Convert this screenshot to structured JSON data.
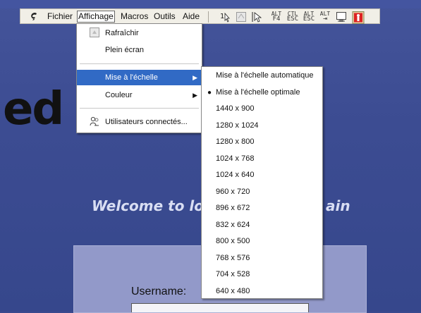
{
  "page": {
    "logo_fragment": "ed",
    "welcome_start": "Welcome to lo",
    "welcome_end": "ain",
    "username_label": "Username:"
  },
  "menubar": {
    "items": [
      {
        "label": "Fichier"
      },
      {
        "label": "Affichage"
      },
      {
        "label": "Macros"
      },
      {
        "label": "Outils"
      },
      {
        "label": "Aide"
      }
    ],
    "toolbar": [
      {
        "name": "pointer-icon",
        "text": "1"
      },
      {
        "name": "disabled-icon",
        "text": ""
      },
      {
        "name": "cursor-icon",
        "text": ""
      },
      {
        "name": "alt-f4-icon",
        "top": "ALT",
        "bottom": "F4"
      },
      {
        "name": "ctrl-esc-icon",
        "top": "CTL",
        "bottom": "ESC"
      },
      {
        "name": "alt-esc-icon",
        "top": "ALT",
        "bottom": "ESC"
      },
      {
        "name": "alt-tab-icon",
        "top": "ALT",
        "bottom": "⇥"
      },
      {
        "name": "monitor-icon",
        "text": ""
      },
      {
        "name": "user-session-icon",
        "text": ""
      }
    ]
  },
  "affichage_menu": {
    "items": [
      {
        "label": "Rafraîchir",
        "icon": "refresh-icon"
      },
      {
        "label": "Plein écran"
      },
      {
        "label": "Mise à l'échelle",
        "submenu": true,
        "highlighted": true
      },
      {
        "label": "Couleur",
        "submenu": true
      },
      {
        "label": "Utilisateurs connectés...",
        "icon": "users-icon"
      }
    ]
  },
  "scale_submenu": {
    "items": [
      {
        "label": "Mise à l'échelle automatique"
      },
      {
        "label": "Mise à l'échelle optimale",
        "selected": true
      },
      {
        "label": "1440 x 900"
      },
      {
        "label": "1280 x 1024"
      },
      {
        "label": "1280 x 800"
      },
      {
        "label": "1024 x 768"
      },
      {
        "label": "1024 x 640"
      },
      {
        "label": "960 x 720"
      },
      {
        "label": "896 x 672"
      },
      {
        "label": "832 x 624"
      },
      {
        "label": "800 x 500"
      },
      {
        "label": "768 x 576"
      },
      {
        "label": "704 x 528"
      },
      {
        "label": "640 x 480"
      }
    ]
  }
}
